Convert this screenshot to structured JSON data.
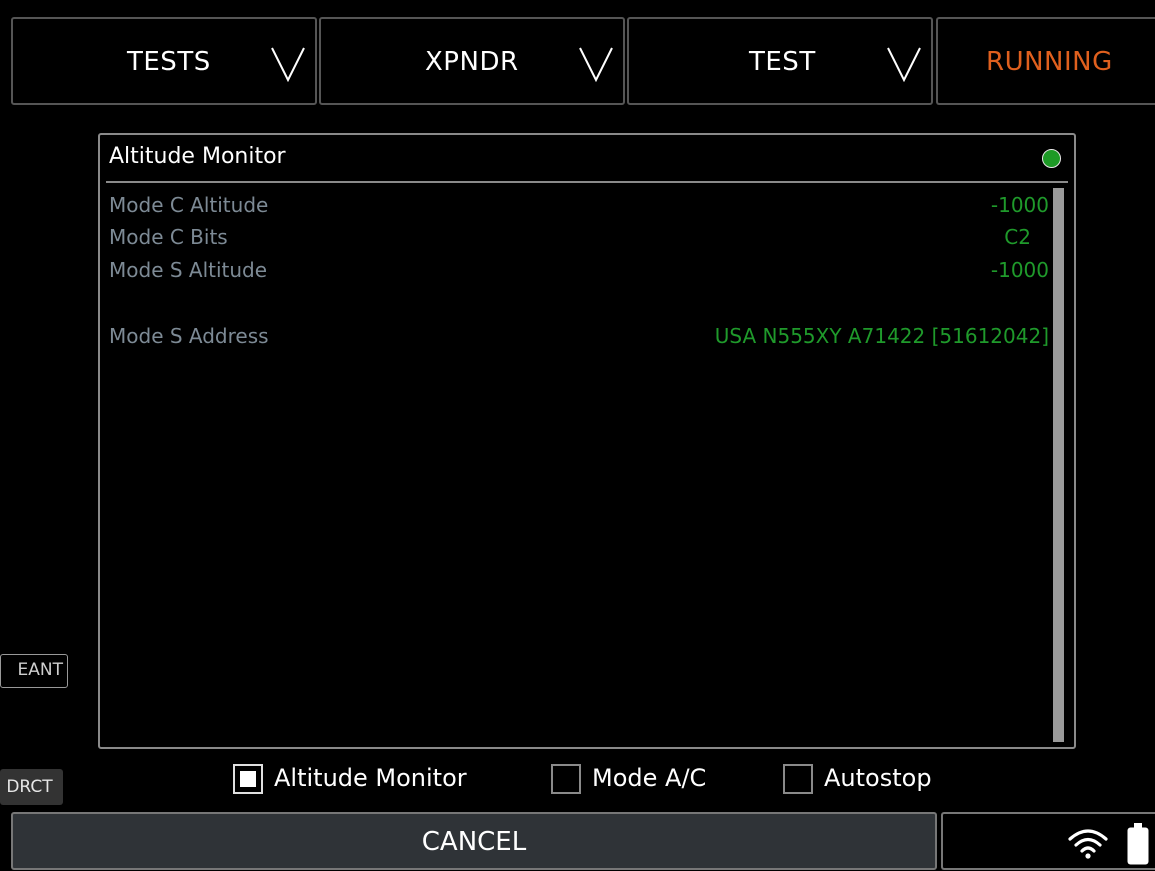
{
  "top_bar": {
    "tests_label": "TESTS",
    "xpndr_label": "XPNDR",
    "test_label": "TEST",
    "running_label": "RUNNING",
    "running_color": "#e0601e",
    "dropdown_icon": "chevron-down-icon"
  },
  "panel": {
    "title": "Altitude Monitor",
    "status_color": "#1d9a26",
    "rows": [
      {
        "label": "Mode C Altitude",
        "value": "-1000"
      },
      {
        "label": "Mode C Bits",
        "value": "C2"
      },
      {
        "label": "Mode S Altitude",
        "value": "-1000"
      },
      {
        "label": "Mode S Address",
        "value": "USA N555XY A71422 [51612042]"
      }
    ]
  },
  "side": {
    "eant_label": "EANT",
    "drct_label": "DRCT"
  },
  "checkboxes": [
    {
      "label": "Altitude Monitor",
      "checked": true
    },
    {
      "label": "Mode A/C",
      "checked": false
    },
    {
      "label": "Autostop",
      "checked": false
    }
  ],
  "bottom": {
    "cancel_label": "CANCEL",
    "wifi_icon": "wifi-icon",
    "battery_icon": "battery-icon"
  },
  "colors": {
    "value_green": "#1f9a2b",
    "label_gray": "#7d8a95"
  }
}
